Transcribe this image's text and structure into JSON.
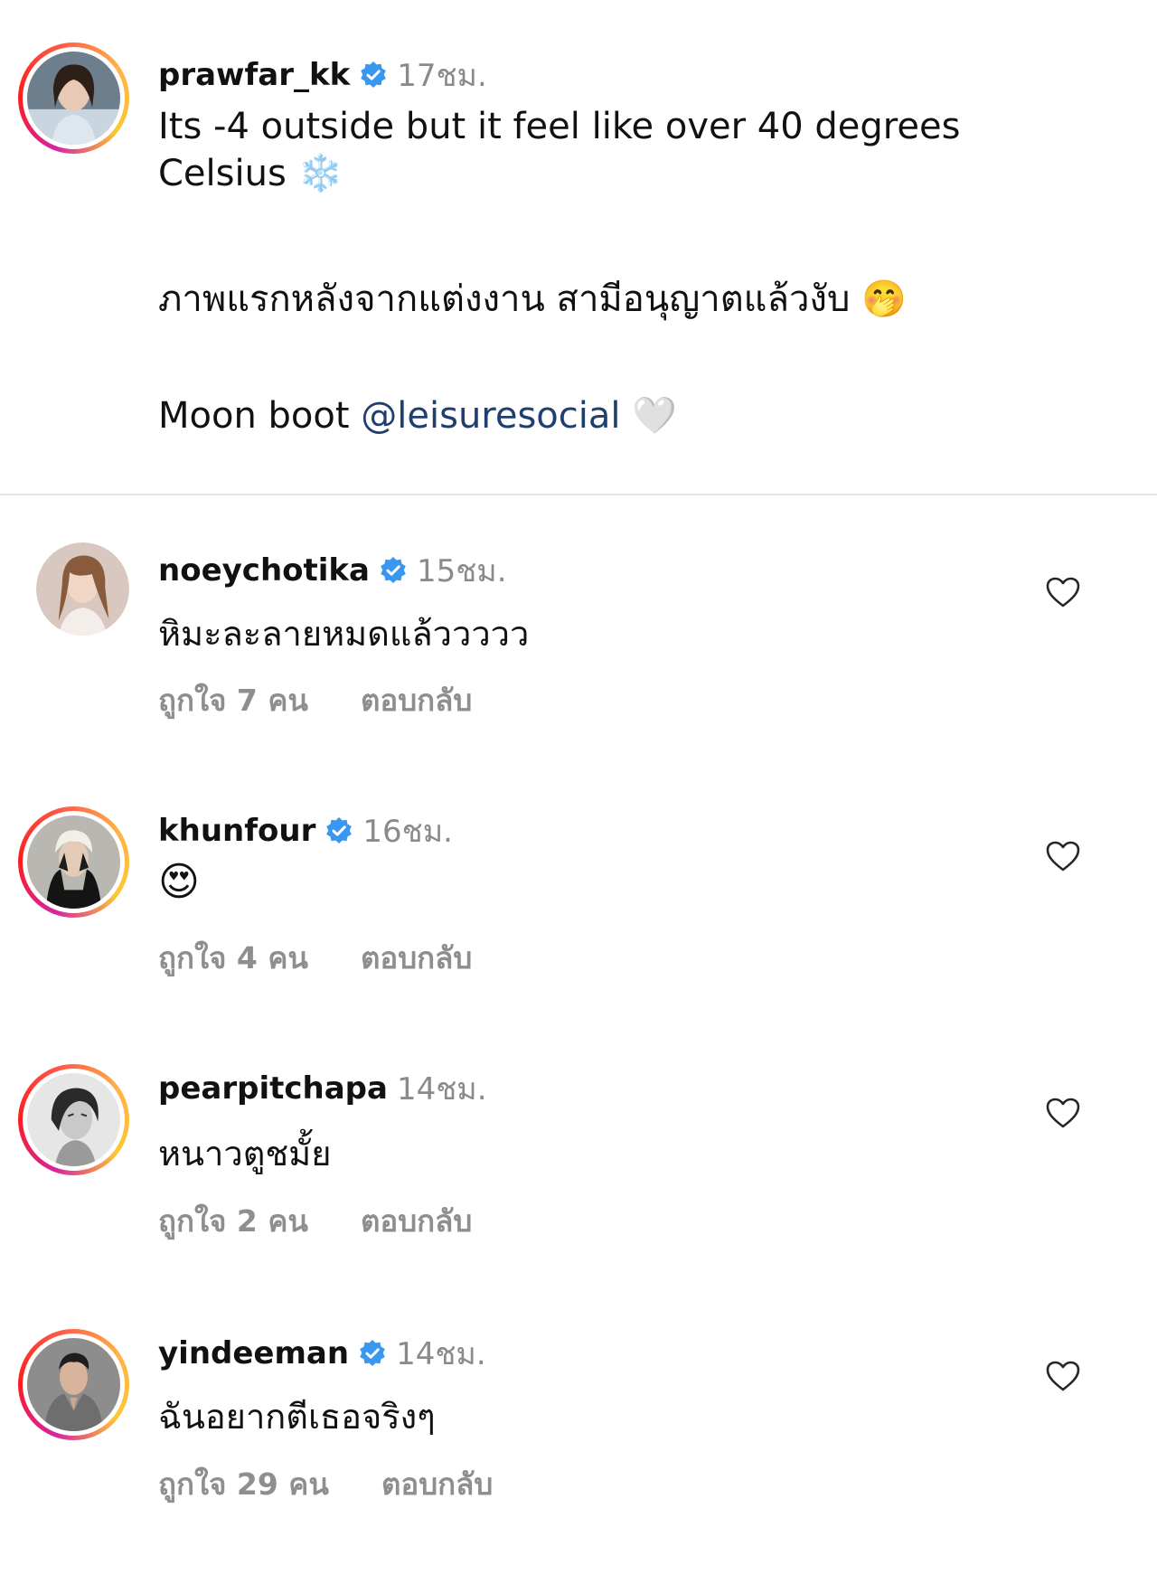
{
  "post": {
    "username": "prawfar_kk",
    "time": "17ชม.",
    "caption_lines": [
      "Its -4 outside but it feel like over 40 degrees",
      "Celsius"
    ],
    "caption_emoji_1": "❄️",
    "caption_thai": "ภาพแรกหลังจากแต่งงาน สามีอนุญาตแล้วงับ",
    "caption_emoji_2": "🤭",
    "caption_moon_prefix": "Moon boot",
    "caption_mention": "@leisuresocial",
    "caption_emoji_3": "🤍"
  },
  "comments": [
    {
      "username": "noeychotika",
      "time": "15ชม.",
      "text": "หิมะละลายหมดแล้ววววว",
      "likes": "ถูกใจ 7 คน",
      "reply": "ตอบกลับ"
    },
    {
      "username": "khunfour",
      "time": "16ชม.",
      "text": "😍",
      "likes": "ถูกใจ 4 คน",
      "reply": "ตอบกลับ"
    },
    {
      "username": "pearpitchapa",
      "time": "14ชม.",
      "text": "หนาวตูชมั้ย",
      "likes": "ถูกใจ 2 คน",
      "reply": "ตอบกลับ"
    },
    {
      "username": "yindeeman",
      "time": "14ชม.",
      "text": "ฉันอยากตีเธอจริงๆ",
      "likes": "ถูกใจ 29 คน",
      "reply": "ตอบกลับ"
    }
  ],
  "colors": {
    "verified_badge": "#3897f0",
    "mention": "#1f3f6e",
    "muted_text": "#8e8e8e",
    "divider": "#e6e6e6"
  },
  "icons": {
    "verified": "verified-badge-icon",
    "like": "heart-outline-icon"
  }
}
